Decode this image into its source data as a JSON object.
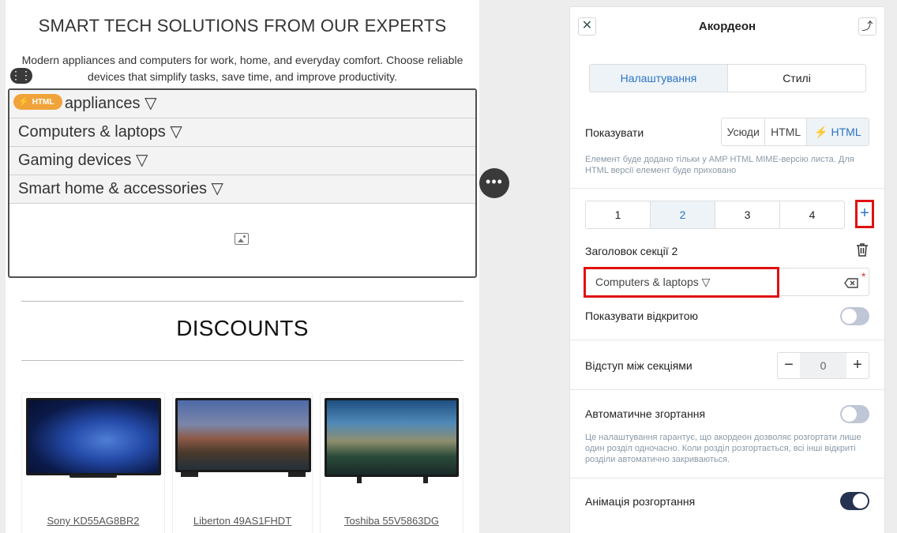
{
  "canvas": {
    "hero_title": "SMART TECH SOLUTIONS FROM OUR EXPERTS",
    "hero_text": "Modern appliances and computers for work, home, and everyday comfort. Choose reliable devices that simplify tasks, save time, and improve productivity.",
    "html_badge": "HTML",
    "accordion": [
      "Home appliances ▽",
      "Computers & laptops ▽",
      "Gaming devices ▽",
      "Smart home & accessories ▽"
    ],
    "discounts_title": "DISCOUNTS",
    "products": [
      {
        "name": "Sony KD55AG8BR2"
      },
      {
        "name": "Liberton 49AS1FHDT"
      },
      {
        "name": "Toshiba 55V5863DG"
      }
    ]
  },
  "panel": {
    "title": "Акордеон",
    "tabs": [
      "Налаштування",
      "Стилі"
    ],
    "show_label": "Показувати",
    "show_options": [
      "Усюди",
      "HTML",
      "HTML"
    ],
    "show_note": "Елемент буде додано тільки у AMP HTML MIME-версію листа. Для HTML версії елемент буде приховано",
    "sections": [
      "1",
      "2",
      "3",
      "4"
    ],
    "active_section": "2",
    "section_header_label": "Заголовок секції 2",
    "section_header_value": "Computers & laptops ▽",
    "show_open_label": "Показувати відкритою",
    "show_open": false,
    "spacing_label": "Відступ між секціями",
    "spacing_value": "0",
    "autocollapse_label": "Автоматичне згортання",
    "autocollapse": false,
    "autocollapse_note": "Це налаштування гарантує, що акордеон дозволяє розгортати лише один розділ одночасно. Коли розділ розгортається, всі інші відкриті розділи автоматично закриваються.",
    "animation_label": "Анімація розгортання",
    "animation": true
  },
  "colors": {
    "accent_blue": "#2b74c4",
    "highlight_red": "#e01010",
    "toggle_on": "#253350",
    "toggle_off": "#bfc6d6",
    "badge_orange": "#f0a33a"
  },
  "icons": [
    "drag-dots-icon",
    "bolt-icon",
    "image-placeholder-icon",
    "more-dots-icon",
    "close-icon",
    "upload-icon",
    "plus-icon",
    "trash-icon",
    "clear-backspace-icon",
    "minus-icon"
  ]
}
